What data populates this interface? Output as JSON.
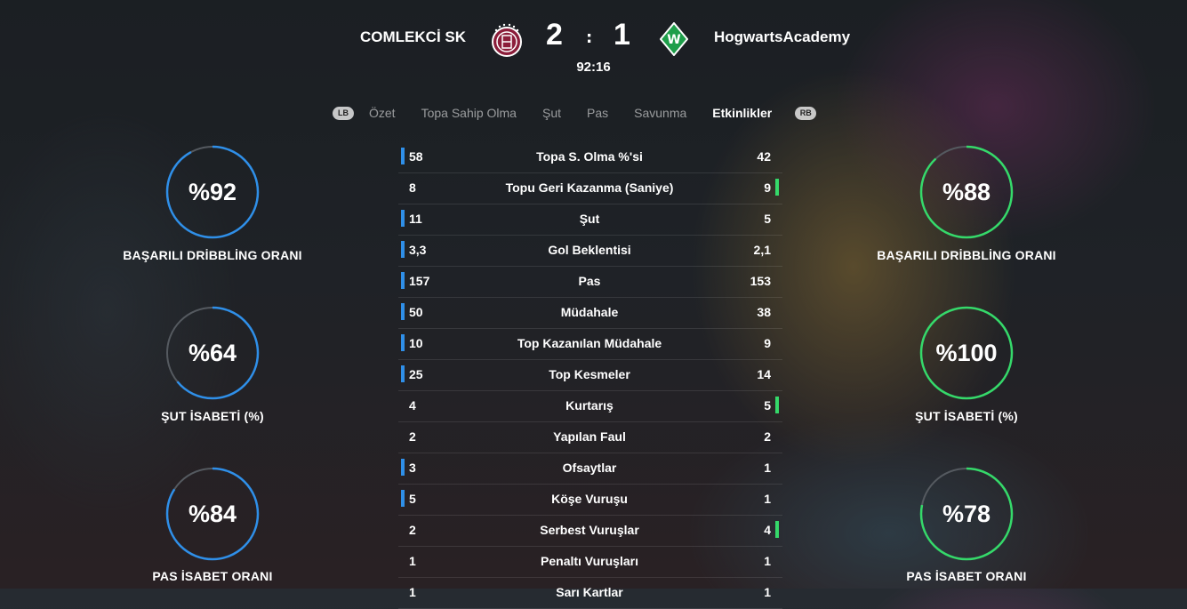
{
  "header": {
    "home_team": "COMLEKCİ SK",
    "away_team": "HogwartsAcademy",
    "home_score": "2",
    "away_score": "1",
    "separator": ":",
    "clock": "92:16",
    "home_crest_icon": "home-club-crest-icon",
    "away_crest_icon": "away-club-crest-icon"
  },
  "tabs": {
    "left_button": "LB",
    "right_button": "RB",
    "items": [
      {
        "label": "Özet",
        "active": false
      },
      {
        "label": "Topa Sahip Olma",
        "active": false
      },
      {
        "label": "Şut",
        "active": false
      },
      {
        "label": "Pas",
        "active": false
      },
      {
        "label": "Savunma",
        "active": false
      },
      {
        "label": "Etkinlikler",
        "active": true
      }
    ]
  },
  "colors": {
    "home_accent": "#2f8fe8",
    "away_accent": "#35d96a",
    "ring_track": "#555a60"
  },
  "home_rings": [
    {
      "value": "%92",
      "percent": 92,
      "label": "BAŞARILI DRİBBLİNG ORANI"
    },
    {
      "value": "%64",
      "percent": 64,
      "label": "ŞUT İSABETİ (%)"
    },
    {
      "value": "%84",
      "percent": 84,
      "label": "PAS İSABET ORANI"
    }
  ],
  "away_rings": [
    {
      "value": "%88",
      "percent": 88,
      "label": "BAŞARILI DRİBBLİNG ORANI"
    },
    {
      "value": "%100",
      "percent": 100,
      "label": "ŞUT İSABETİ (%)"
    },
    {
      "value": "%78",
      "percent": 78,
      "label": "PAS İSABET ORANI"
    }
  ],
  "stats": [
    {
      "label": "Topa S. Olma %'si",
      "home": "58",
      "away": "42",
      "leader": "home"
    },
    {
      "label": "Topu Geri Kazanma (Saniye)",
      "home": "8",
      "away": "9",
      "leader": "away"
    },
    {
      "label": "Şut",
      "home": "11",
      "away": "5",
      "leader": "home"
    },
    {
      "label": "Gol Beklentisi",
      "home": "3,3",
      "away": "2,1",
      "leader": "home"
    },
    {
      "label": "Pas",
      "home": "157",
      "away": "153",
      "leader": "home"
    },
    {
      "label": "Müdahale",
      "home": "50",
      "away": "38",
      "leader": "home"
    },
    {
      "label": "Top Kazanılan Müdahale",
      "home": "10",
      "away": "9",
      "leader": "home"
    },
    {
      "label": "Top Kesmeler",
      "home": "25",
      "away": "14",
      "leader": "home"
    },
    {
      "label": "Kurtarış",
      "home": "4",
      "away": "5",
      "leader": "away"
    },
    {
      "label": "Yapılan Faul",
      "home": "2",
      "away": "2",
      "leader": "none"
    },
    {
      "label": "Ofsaytlar",
      "home": "3",
      "away": "1",
      "leader": "home"
    },
    {
      "label": "Köşe Vuruşu",
      "home": "5",
      "away": "1",
      "leader": "home"
    },
    {
      "label": "Serbest Vuruşlar",
      "home": "2",
      "away": "4",
      "leader": "away"
    },
    {
      "label": "Penaltı Vuruşları",
      "home": "1",
      "away": "1",
      "leader": "none"
    },
    {
      "label": "Sarı Kartlar",
      "home": "1",
      "away": "1",
      "leader": "none"
    }
  ]
}
